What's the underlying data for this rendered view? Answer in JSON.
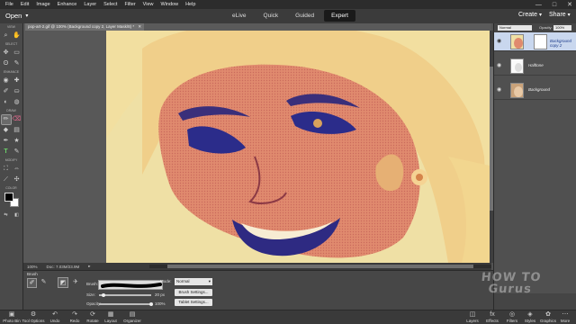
{
  "menu": {
    "items": [
      "File",
      "Edit",
      "Image",
      "Enhance",
      "Layer",
      "Select",
      "Filter",
      "View",
      "Window",
      "Help"
    ],
    "minimize": "—",
    "maximize": "□",
    "close": "✕"
  },
  "topbar": {
    "open_label": "Open",
    "open_chevron": "▾",
    "tabs": [
      "eLive",
      "Quick",
      "Guided",
      "Expert"
    ],
    "active_tab": "Expert",
    "create_label": "Create",
    "share_label": "Share",
    "chevron": "▾"
  },
  "toolpanel": {
    "sections": {
      "view": "VIEW",
      "select": "SELECT",
      "enhance": "ENHANCE",
      "draw": "DRAW",
      "modify": "MODIFY",
      "color": "COLOR"
    },
    "icons": {
      "zoom": "⌕",
      "hand": "✋",
      "move": "✥",
      "marquee": "▭",
      "lasso": "ʘ",
      "quick_select": "✎",
      "eye": "◉",
      "spot_heal": "✚",
      "smart_brush": "✐",
      "clone": "⛀",
      "sponge": "◐",
      "dodge": "◍",
      "brush": "✏",
      "eraser": "⌫",
      "paint_bucket": "◆",
      "gradient": "▤",
      "eyedropper": "✒",
      "shape": "★",
      "type": "T",
      "pencil": "✎",
      "crop": "⛶",
      "recompose": "⇔",
      "straighten": "⟋",
      "content_move": "✣",
      "swap": "⇆",
      "reset": "◧"
    },
    "fg_color": "#000000",
    "bg_color": "#ffffff"
  },
  "document": {
    "tab_label": "pop-art-2.gif @ 100% (Background copy 2, Layer Mask/8) *",
    "close": "✕",
    "zoom": "100%",
    "doc_info": "Doc: 7.03M/23.9M",
    "arrow": "▸"
  },
  "tool_options": {
    "brush_label": "Brush",
    "brush_field_label": "Brush:",
    "size_label": "Size:",
    "size_value": "20 px",
    "size_fraction": 0.08,
    "opacity_label": "Opacity:",
    "opacity_value": "100%",
    "opacity_fraction": 1.0,
    "mode_label": "Mode:",
    "mode_value": "Normal",
    "mode_chevron": "▾",
    "brush_settings": "Brush Settings...",
    "tablet_settings": "Tablet Settings...",
    "icons": {
      "brush_mode_a": "✐",
      "brush_mode_b": "✎",
      "airbrush_a": "◩",
      "airbrush_b": "✈"
    }
  },
  "layers": {
    "blend_mode": "Normal",
    "opacity_label": "Opacity:",
    "opacity_value": "100%",
    "eye_icon": "◉",
    "items": [
      {
        "name": "Background copy 2",
        "selected": true,
        "has_mask": true
      },
      {
        "name": "Halftone",
        "selected": false,
        "has_mask": false
      },
      {
        "name": "Background",
        "selected": false,
        "has_mask": false
      }
    ]
  },
  "taskbar": {
    "left": [
      {
        "label": "Photo Bin",
        "icon": "▣"
      },
      {
        "label": "Tool Options",
        "icon": "⚙"
      },
      {
        "label": "Undo",
        "icon": "↶"
      },
      {
        "label": "Redo",
        "icon": "↷"
      },
      {
        "label": "Rotate",
        "icon": "⟳"
      },
      {
        "label": "Layout",
        "icon": "▦"
      },
      {
        "label": "Organizer",
        "icon": "▤"
      }
    ],
    "right": [
      {
        "label": "Layers",
        "icon": "◫"
      },
      {
        "label": "Effects",
        "icon": "fx"
      },
      {
        "label": "Filters",
        "icon": "◎"
      },
      {
        "label": "Styles",
        "icon": "◈"
      },
      {
        "label": "Graphics",
        "icon": "✿"
      },
      {
        "label": "More",
        "icon": "⋯"
      }
    ]
  },
  "watermark": {
    "line1": "HOW TO",
    "line2": "Gurus"
  }
}
